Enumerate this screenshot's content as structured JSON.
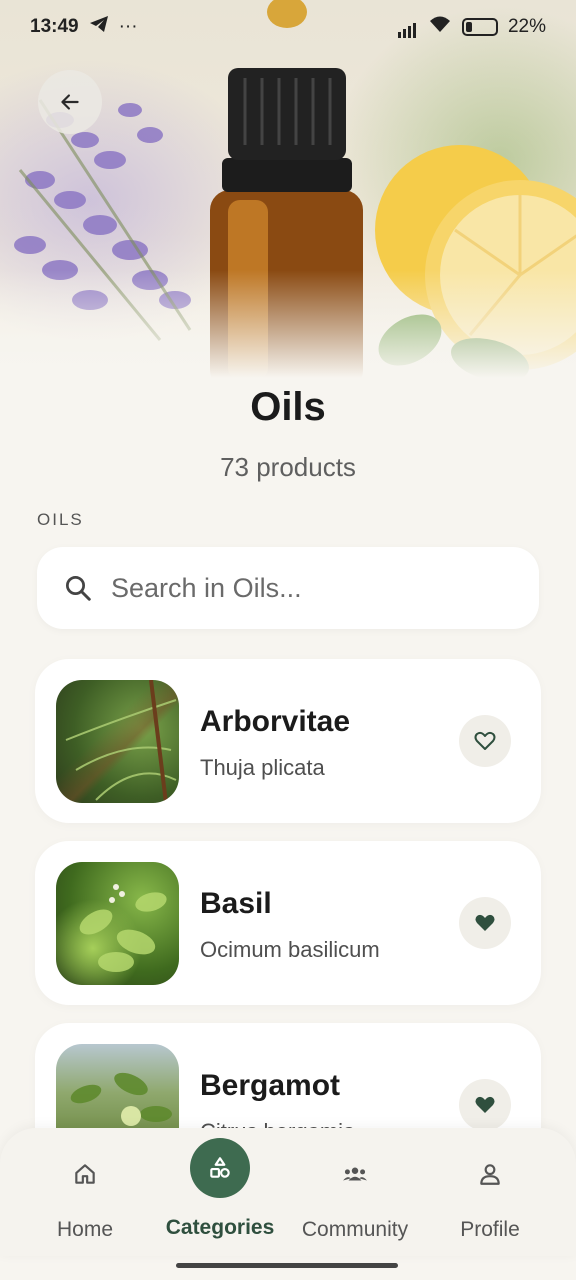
{
  "status_bar": {
    "time": "13:49",
    "battery": "22%"
  },
  "header": {
    "title": "Oils",
    "product_count": "73 products",
    "section_label": "OILS"
  },
  "search": {
    "placeholder": "Search in Oils..."
  },
  "products": [
    {
      "name": "Arborvitae",
      "latin": "Thuja plicata",
      "favorited": false
    },
    {
      "name": "Basil",
      "latin": "Ocimum basilicum",
      "favorited": true
    },
    {
      "name": "Bergamot",
      "latin": "Citrus bergamia",
      "favorited": true
    }
  ],
  "bottom_nav": {
    "items": [
      {
        "label": "Home",
        "icon": "home-icon"
      },
      {
        "label": "Categories",
        "icon": "categories-icon",
        "active": true
      },
      {
        "label": "Community",
        "icon": "community-icon"
      },
      {
        "label": "Profile",
        "icon": "profile-icon"
      }
    ]
  },
  "colors": {
    "accent": "#3e6b50",
    "background": "#f7f5f0"
  }
}
